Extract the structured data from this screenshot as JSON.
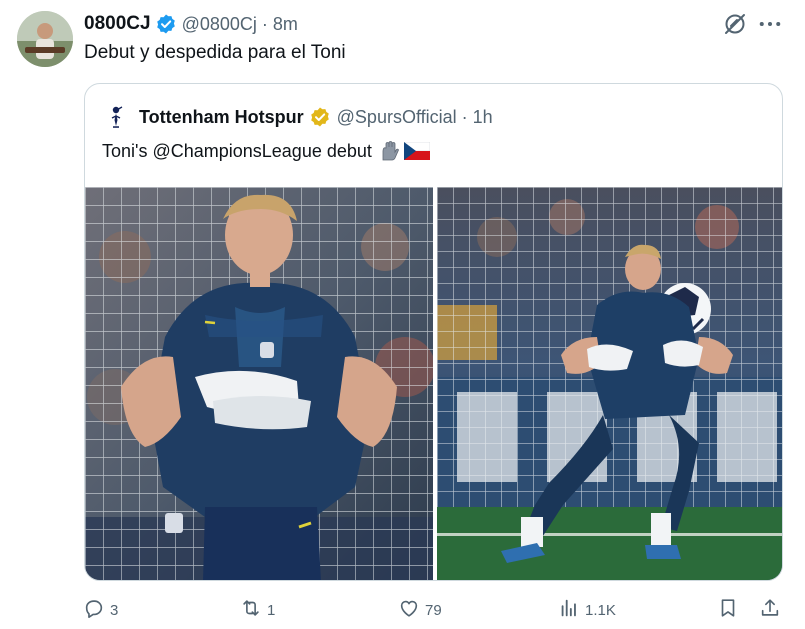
{
  "tweet": {
    "author": {
      "display_name": "0800CJ",
      "handle": "@0800Cj",
      "verified": true
    },
    "separator": "·",
    "time": "8m",
    "text": "Debut y despedida para el Toni"
  },
  "quote": {
    "author": {
      "display_name": "Tottenham Hotspur",
      "handle": "@SpursOfficial",
      "verified": true
    },
    "separator": "·",
    "time": "1h",
    "text": "Toni's @ChampionsLeague debut"
  },
  "actions": {
    "replies": "3",
    "retweets": "1",
    "likes": "79",
    "views": "1.1K"
  },
  "icons": {
    "verified": "verified-badge-icon",
    "grok": "grok-icon",
    "more": "more-icon",
    "reply": "reply-icon",
    "retweet": "retweet-icon",
    "like": "heart-icon",
    "views": "views-icon",
    "bookmark": "bookmark-icon",
    "share": "share-icon"
  },
  "colors": {
    "verified_blue": "#1d9bf0",
    "verified_gold": "#e2b719",
    "text_primary": "#0f1419",
    "text_secondary": "#536471",
    "border": "#cfd9de"
  }
}
